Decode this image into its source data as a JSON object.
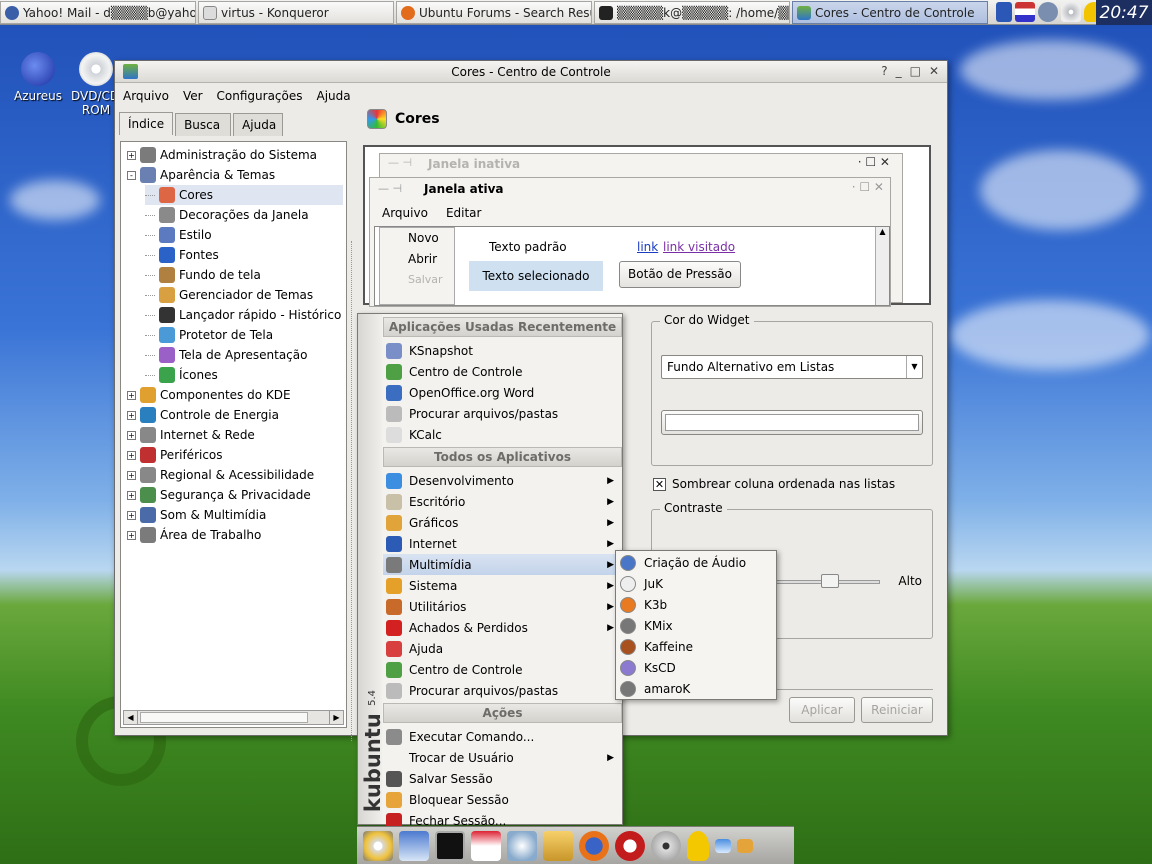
{
  "taskbar": {
    "tasks": [
      {
        "label": "Yahoo! Mail - d▒▒▒▒b@yahoo.c",
        "icon": "yahoo-globe-icon"
      },
      {
        "label": "virtus - Konqueror",
        "icon": "konqueror-icon"
      },
      {
        "label": "Ubuntu Forums - Search Results",
        "icon": "ubuntu-forums-icon"
      },
      {
        "label": "▒▒▒▒▒k@▒▒▒▒▒: /home/▒▒▒▒▒ - S",
        "icon": "terminal-icon"
      },
      {
        "label": "Cores - Centro de Controle",
        "icon": "control-center-icon"
      }
    ],
    "tray_icons": [
      "kde-icon",
      "flag-icon",
      "network-icon",
      "cd-icon",
      "user-icon"
    ],
    "clock": "20:47"
  },
  "desktop_icons": [
    {
      "label": "Azureus",
      "icon": "azureus-frog-icon"
    },
    {
      "label": "DVD/CD-ROM",
      "icon": "cdrom-icon"
    }
  ],
  "window": {
    "title": "Cores - Centro de Controle",
    "controls": [
      "?",
      "_",
      "□",
      "✕"
    ],
    "menu": [
      "Arquivo",
      "Ver",
      "Configurações",
      "Ajuda"
    ],
    "tabs": [
      "Índice",
      "Busca",
      "Ajuda"
    ],
    "tree": [
      {
        "label": "Administração do Sistema",
        "level": 0,
        "expander": "+"
      },
      {
        "label": "Aparência & Temas",
        "level": 0,
        "expander": "-"
      },
      {
        "label": "Cores",
        "level": 1,
        "selected": true
      },
      {
        "label": "Decorações da Janela",
        "level": 1
      },
      {
        "label": "Estilo",
        "level": 1
      },
      {
        "label": "Fontes",
        "level": 1
      },
      {
        "label": "Fundo de tela",
        "level": 1
      },
      {
        "label": "Gerenciador de Temas",
        "level": 1
      },
      {
        "label": "Lançador rápido - Histórico",
        "level": 1
      },
      {
        "label": "Protetor de Tela",
        "level": 1
      },
      {
        "label": "Tela de Apresentação",
        "level": 1
      },
      {
        "label": "Ícones",
        "level": 1
      },
      {
        "label": "Componentes do KDE",
        "level": 0,
        "expander": "+"
      },
      {
        "label": "Controle de Energia",
        "level": 0,
        "expander": "+"
      },
      {
        "label": "Internet & Rede",
        "level": 0,
        "expander": "+"
      },
      {
        "label": "Periféricos",
        "level": 0,
        "expander": "+"
      },
      {
        "label": "Regional & Acessibilidade",
        "level": 0,
        "expander": "+"
      },
      {
        "label": "Segurança & Privacidade",
        "level": 0,
        "expander": "+"
      },
      {
        "label": "Som & Multimídia",
        "level": 0,
        "expander": "+"
      },
      {
        "label": "Área de Trabalho",
        "level": 0,
        "expander": "+"
      }
    ],
    "section_title": "Cores",
    "preview": {
      "inactive_title": "Janela inativa",
      "active_title": "Janela ativa",
      "menu": [
        "Arquivo",
        "Editar"
      ],
      "popup": [
        "Novo",
        "Abrir",
        "Salvar"
      ],
      "standard_text": "Texto padrão",
      "link": "link",
      "visited_link": "link visitado",
      "selected_text": "Texto selecionado",
      "push_button": "Botão de Pressão"
    },
    "widget_color": {
      "legend": "Cor do Widget",
      "selected": "Fundo Alternativo em Listas",
      "checkbox_label": "Sombrear coluna ordenada nas listas",
      "checkbox_checked": true
    },
    "contrast": {
      "legend": "Contraste",
      "high_label": "Alto"
    },
    "buttons": {
      "apply": "Aplicar",
      "reset": "Reiniciar"
    }
  },
  "kmenu": {
    "side_logo": "kubuntu",
    "side_version": "5.4",
    "recent_header": "Aplicações Usadas Recentemente",
    "recent": [
      {
        "label": "KSnapshot",
        "icon": "ksnapshot-icon"
      },
      {
        "label": "Centro de Controle",
        "icon": "control-center-icon"
      },
      {
        "label": "OpenOffice.org Word",
        "icon": "openoffice-writer-icon"
      },
      {
        "label": "Procurar arquivos/pastas",
        "icon": "search-files-icon"
      },
      {
        "label": "KCalc",
        "icon": "kcalc-icon"
      }
    ],
    "all_header": "Todos os Aplicativos",
    "all": [
      {
        "label": "Desenvolvimento",
        "icon": "development-icon",
        "sub": true
      },
      {
        "label": "Escritório",
        "icon": "office-icon",
        "sub": true
      },
      {
        "label": "Gráficos",
        "icon": "graphics-icon",
        "sub": true
      },
      {
        "label": "Internet",
        "icon": "internet-globe-icon",
        "sub": true
      },
      {
        "label": "Multimídia",
        "icon": "multimedia-icon",
        "sub": true,
        "highlight": true
      },
      {
        "label": "Sistema",
        "icon": "system-icon",
        "sub": true
      },
      {
        "label": "Utilitários",
        "icon": "utilities-icon",
        "sub": true
      },
      {
        "label": "Achados & Perdidos",
        "icon": "lost-found-icon",
        "sub": true
      },
      {
        "label": "Ajuda",
        "icon": "help-icon",
        "sub": false
      },
      {
        "label": "Centro de Controle",
        "icon": "control-center-icon",
        "sub": false
      },
      {
        "label": "Procurar arquivos/pastas",
        "icon": "search-files-icon",
        "sub": false
      }
    ],
    "actions_header": "Ações",
    "actions": [
      {
        "label": "Executar Comando...",
        "icon": "run-command-icon",
        "sub": false
      },
      {
        "label": "Trocar de Usuário",
        "icon": "",
        "sub": true
      },
      {
        "label": "Salvar Sessão",
        "icon": "save-session-icon",
        "sub": false
      },
      {
        "label": "Bloquear Sessão",
        "icon": "lock-icon",
        "sub": false
      },
      {
        "label": "Fechar Sessão...",
        "icon": "logout-icon",
        "sub": false
      }
    ]
  },
  "submenu": [
    {
      "label": "Criação de Áudio",
      "icon": "audio-creation-icon"
    },
    {
      "label": "JuK",
      "icon": "juk-icon"
    },
    {
      "label": "K3b",
      "icon": "k3b-icon"
    },
    {
      "label": "KMix",
      "icon": "kmix-icon"
    },
    {
      "label": "Kaffeine",
      "icon": "kaffeine-icon"
    },
    {
      "label": "KsCD",
      "icon": "kscd-icon"
    },
    {
      "label": "amaroK",
      "icon": "amarok-icon"
    }
  ],
  "panel_icons": [
    "kmenu-icon",
    "show-desktop-icon",
    "terminal-icon",
    "home-icon",
    "media-icon",
    "folders-icon",
    "firefox-icon",
    "opera-icon",
    "cd-player-icon",
    "user-icon",
    "window-icon",
    "lock-icon"
  ]
}
